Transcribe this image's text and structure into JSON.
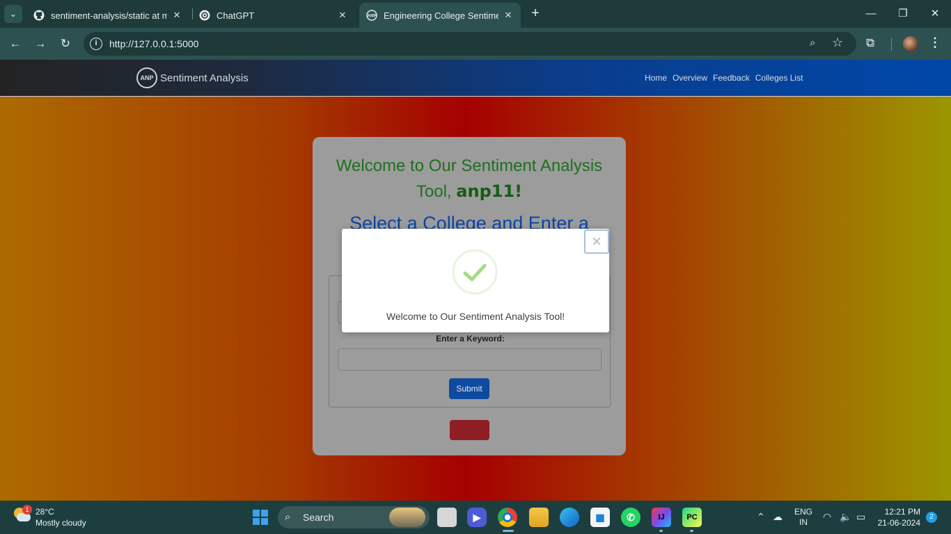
{
  "browser": {
    "tabs": [
      {
        "title": "sentiment-analysis/static at master",
        "icon": "github-icon"
      },
      {
        "title": "ChatGPT",
        "icon": "chatgpt-icon"
      },
      {
        "title": "Engineering College Sentiment",
        "icon": "anp-icon"
      }
    ],
    "active_tab": 2,
    "url": "http://127.0.0.1:5000"
  },
  "site": {
    "brand": "Sentiment Analysis",
    "brand_logo_text": "ANP",
    "nav": [
      "Home",
      "Overview",
      "Feedback",
      "Colleges List"
    ]
  },
  "card": {
    "welcome_prefix": "Welcome to Our Sentiment Analysis Tool,",
    "username": "anp11!",
    "select_heading": "Select a College and Enter a",
    "keyword_label": "Enter a Keyword:",
    "keyword_value": "",
    "submit_label": "Submit"
  },
  "modal": {
    "message": "Welcome to Our Sentiment Analysis Tool!",
    "close_label": "×",
    "status": "success"
  },
  "taskbar": {
    "weather_temp": "28°C",
    "weather_desc": "Mostly cloudy",
    "weather_badge": "1",
    "search_label": "Search",
    "lang_top": "ENG",
    "lang_bottom": "IN",
    "time": "12:21 PM",
    "date": "21-06-2024",
    "notifications": "2"
  },
  "colors": {
    "success_green": "#a5dc86",
    "submit_blue": "#0d4aa0",
    "nav_blue": "#0047a8"
  }
}
